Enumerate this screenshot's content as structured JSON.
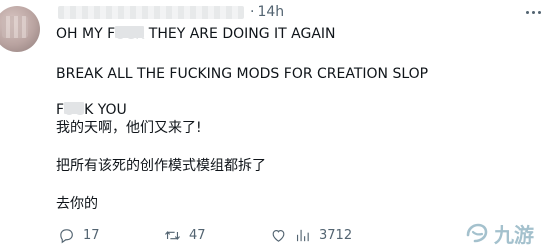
{
  "tweet": {
    "time_separator": "·",
    "timestamp": "14h",
    "lines": {
      "l1_a": "OH MY F",
      "l1_b": "UCK",
      "l1_c": " THEY ARE DOING IT AGAIN",
      "l2": "BREAK ALL THE FUCKING MODS FOR CREATION SLOP",
      "l3_a": "F",
      "l3_b": "UC",
      "l3_c": "K YOU",
      "l4": "我的天啊，他们又来了!",
      "l5": "把所有该死的创作模式模组都拆了",
      "l6": "去你的"
    }
  },
  "actions": {
    "reply_count": "17",
    "retweet_count": "47",
    "views_count": "3712"
  },
  "watermark": {
    "text": "九游"
  },
  "icons": {
    "reply": "reply-icon",
    "retweet": "retweet-icon",
    "like": "heart-icon",
    "views": "views-icon",
    "more": "more-icon"
  }
}
